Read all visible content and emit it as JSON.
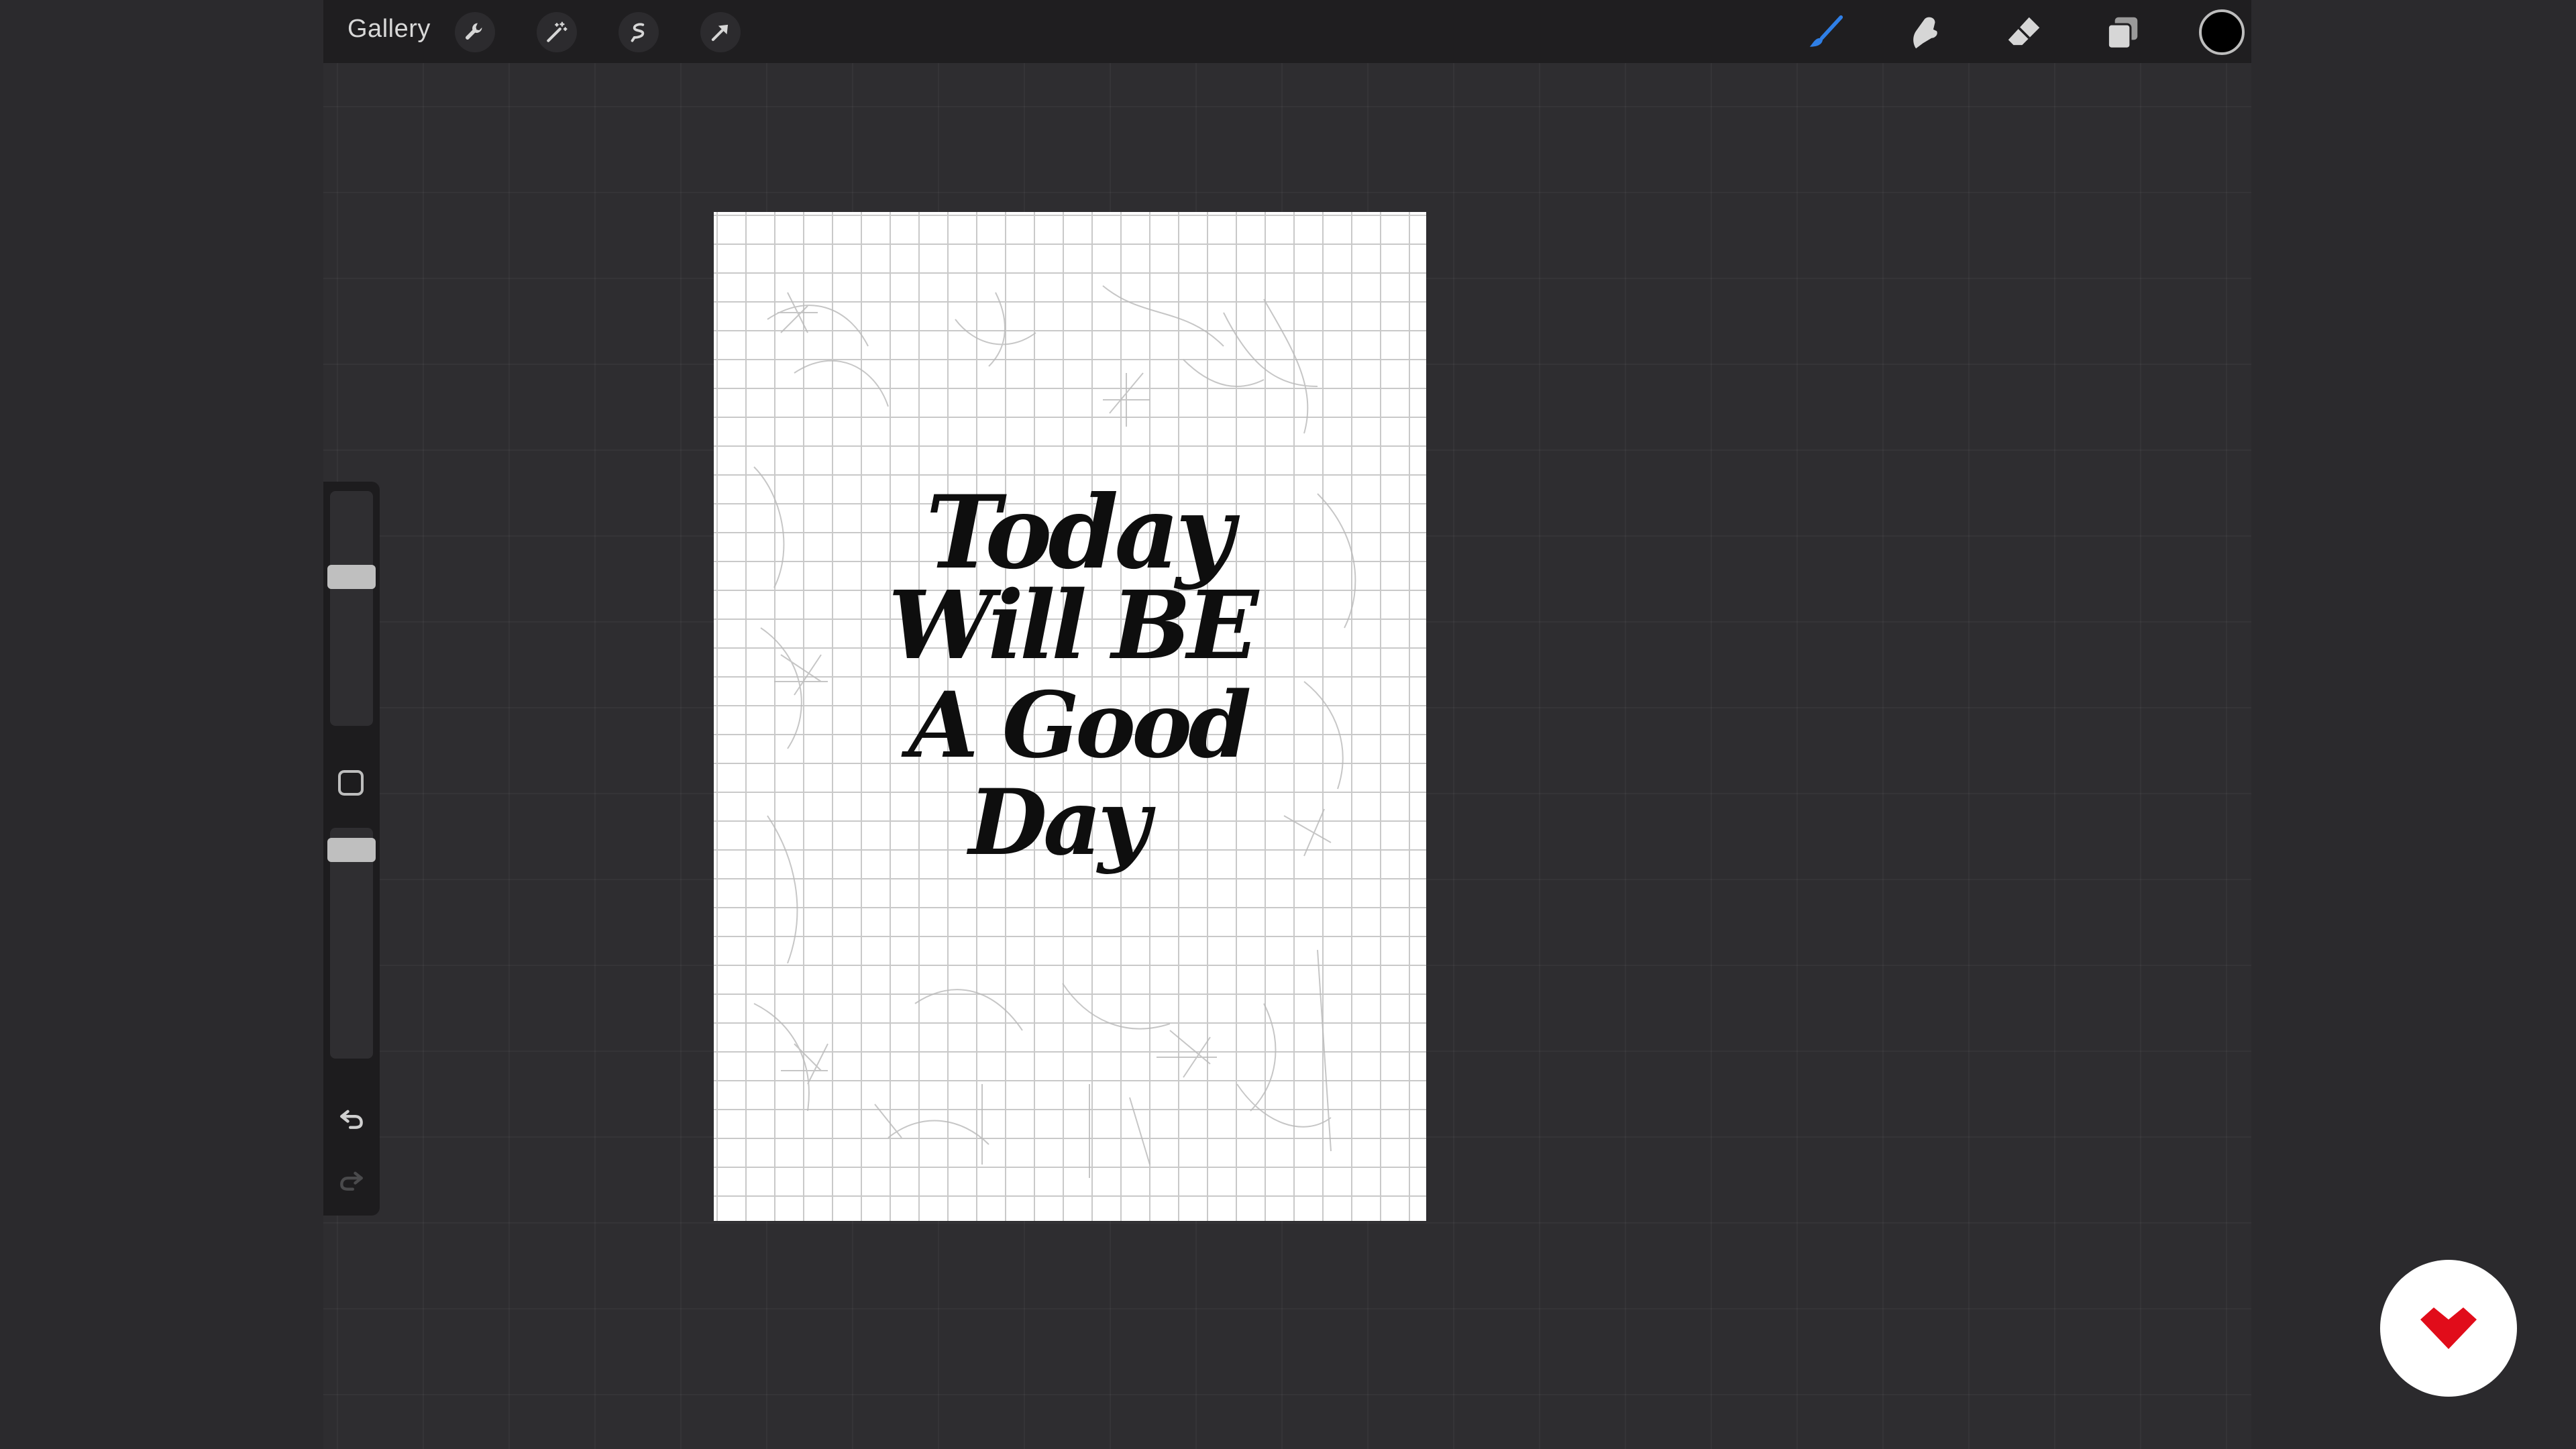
{
  "toolbar": {
    "gallery_label": "Gallery",
    "left_tools": [
      "wrench-icon",
      "magic-wand-icon",
      "selection-icon",
      "transform-arrow-icon"
    ],
    "right_tools": [
      "brush-icon",
      "smudge-icon",
      "eraser-icon",
      "layers-icon"
    ],
    "current_color": "#000000",
    "brush_color": "#2f7fe6"
  },
  "sidebar": {
    "brush_size_level": 0.65,
    "opacity_level": 0.95,
    "tools": [
      "modify-button",
      "undo-icon",
      "redo-icon"
    ]
  },
  "canvas": {
    "lettering_lines": [
      "Today",
      "Will BE",
      "A Good",
      "Day"
    ],
    "background": "#ffffff",
    "grid_color": "#c9c9c9"
  },
  "brand_badge": {
    "color": "#e10c1a"
  }
}
